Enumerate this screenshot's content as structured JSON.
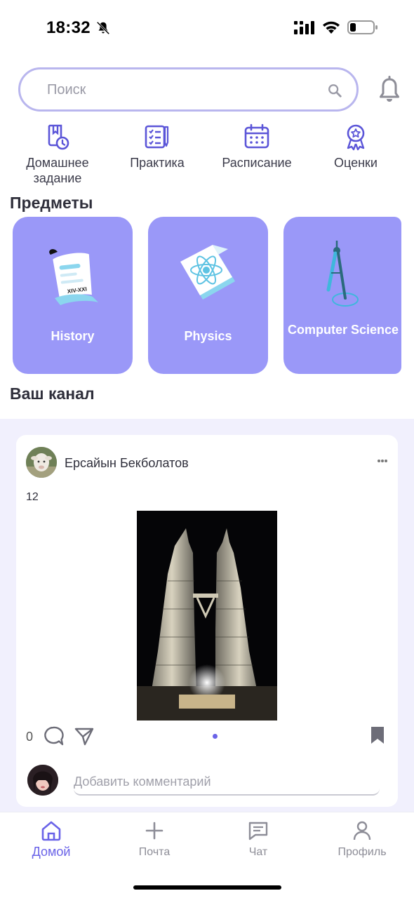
{
  "status_bar": {
    "time": "18:32"
  },
  "search": {
    "placeholder": "Поиск"
  },
  "quick_actions": [
    {
      "label": "Домашнее задание",
      "icon": "homework-icon"
    },
    {
      "label": "Практика",
      "icon": "practice-icon"
    },
    {
      "label": "Расписание",
      "icon": "calendar-icon"
    },
    {
      "label": "Оценки",
      "icon": "award-icon"
    }
  ],
  "subjects_section": {
    "title": "Предметы"
  },
  "subjects": [
    {
      "label": "History",
      "icon": "scroll-icon"
    },
    {
      "label": "Physics",
      "icon": "atom-icon"
    },
    {
      "label": "Computer Science",
      "icon": "compass-icon"
    }
  ],
  "feed_section": {
    "title": "Ваш канал"
  },
  "post": {
    "author": "Ерсайын Бекболатов",
    "text": "12",
    "comment_count": "0",
    "comment_placeholder": "Добавить комментарий",
    "carousel_page": 1,
    "carousel_total": 1
  },
  "bottom_nav": [
    {
      "label": "Домой",
      "icon": "home-icon",
      "active": true
    },
    {
      "label": "Почта",
      "icon": "plus-icon",
      "active": false
    },
    {
      "label": "Чат",
      "icon": "chat-icon",
      "active": false
    },
    {
      "label": "Профиль",
      "icon": "profile-icon",
      "active": false
    }
  ],
  "colors": {
    "accent": "#6a63e8",
    "card": "#9a98f8",
    "search_border": "#b9b6ee",
    "feed_bg": "#f1f0fd"
  }
}
